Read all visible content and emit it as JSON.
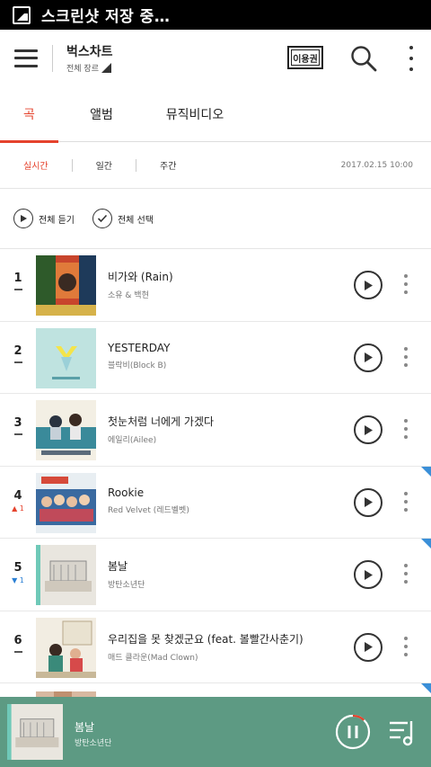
{
  "status_bar": {
    "text": "스크린샷 저장 중…",
    "icon": "screenshot-icon"
  },
  "header": {
    "title": "벅스차트",
    "genre": "전체 장르",
    "ticket_label": "이용권",
    "icons": [
      "menu-icon",
      "search-icon",
      "more-vert-icon"
    ]
  },
  "tabs": [
    {
      "label": "곡",
      "active": true
    },
    {
      "label": "앨범",
      "active": false
    },
    {
      "label": "뮤직비디오",
      "active": false
    }
  ],
  "periods": [
    {
      "label": "실시간",
      "active": true
    },
    {
      "label": "일간",
      "active": false
    },
    {
      "label": "주간",
      "active": false
    }
  ],
  "timestamp": "2017.02.15 10:00",
  "actions": {
    "play_all": "전체 듣기",
    "select_all": "전체 선택"
  },
  "songs": [
    {
      "rank": "1",
      "change": "same",
      "change_value": "",
      "title": "비가와 (Rain)",
      "artist": "소유 & 백현",
      "badge": false
    },
    {
      "rank": "2",
      "change": "same",
      "change_value": "",
      "title": "YESTERDAY",
      "artist": "블락비(Block B)",
      "badge": false
    },
    {
      "rank": "3",
      "change": "same",
      "change_value": "",
      "title": "첫눈처럼 너에게 가겠다",
      "artist": "에일리(Ailee)",
      "badge": false
    },
    {
      "rank": "4",
      "change": "up",
      "change_value": "1",
      "title": "Rookie",
      "artist": "Red Velvet (레드벨벳)",
      "badge": true
    },
    {
      "rank": "5",
      "change": "down",
      "change_value": "1",
      "title": "봄날",
      "artist": "방탄소년단",
      "badge": true
    },
    {
      "rank": "6",
      "change": "same",
      "change_value": "",
      "title": "우리집을 못 찾겠군요 (feat. 볼빨간사춘기)",
      "artist": "매드 클라운(Mad Clown)",
      "badge": false
    }
  ],
  "mini_player": {
    "title": "봄날",
    "artist": "방탄소년단",
    "progress": 0.12
  },
  "colors": {
    "accent": "#e5432d",
    "player_bg": "#5d9a83",
    "badge": "#3a8fd8"
  }
}
